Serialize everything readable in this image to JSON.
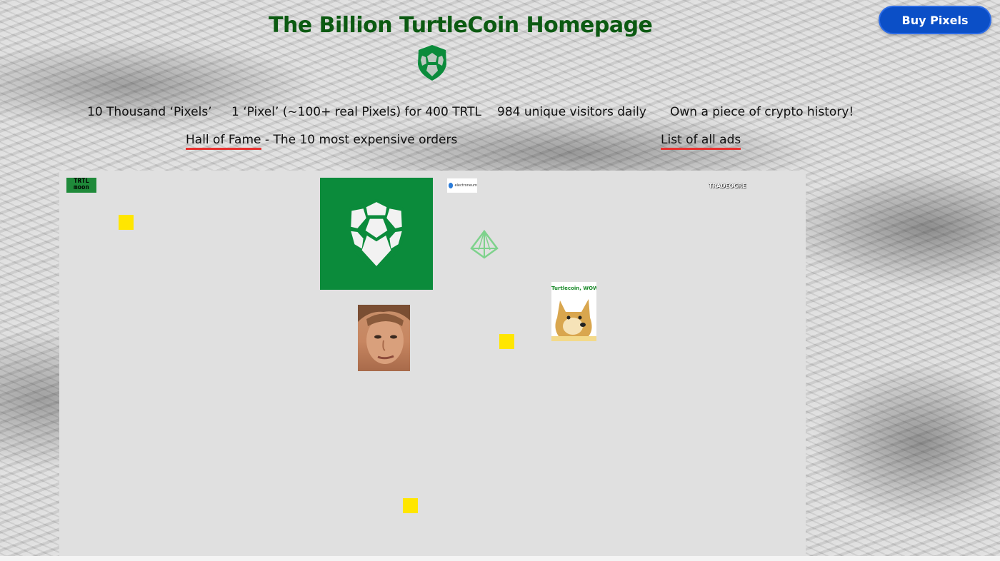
{
  "header": {
    "title": "The Billion TurtleCoin Homepage",
    "buy_button": "Buy Pixels"
  },
  "stats": [
    "10 Thousand ‘Pixels’",
    "1 ‘Pixel’ (~100+ real Pixels) for 400 TRTL",
    "984 unique visitors daily",
    "Own a piece of crypto history!"
  ],
  "links": {
    "hall_of_fame": "Hall of Fame",
    "hall_of_fame_suffix": " - The 10 most expensive orders",
    "list_of_ads": "List of all ads"
  },
  "ads": {
    "trtl_moon_line1": "TRTL",
    "trtl_moon_line2": "moon",
    "electroneum": "electroneum",
    "tradeogre": "TRADEOGRE",
    "doge_caption": "Turtlecoin, WOW!"
  },
  "colors": {
    "title_green": "#0c5a12",
    "turtle_green": "#0b8b3b",
    "button_blue": "#0b4fc7",
    "link_underline": "#e8312f",
    "canvas_bg": "#e0e0e0",
    "pixel_yellow": "#ffe600"
  }
}
